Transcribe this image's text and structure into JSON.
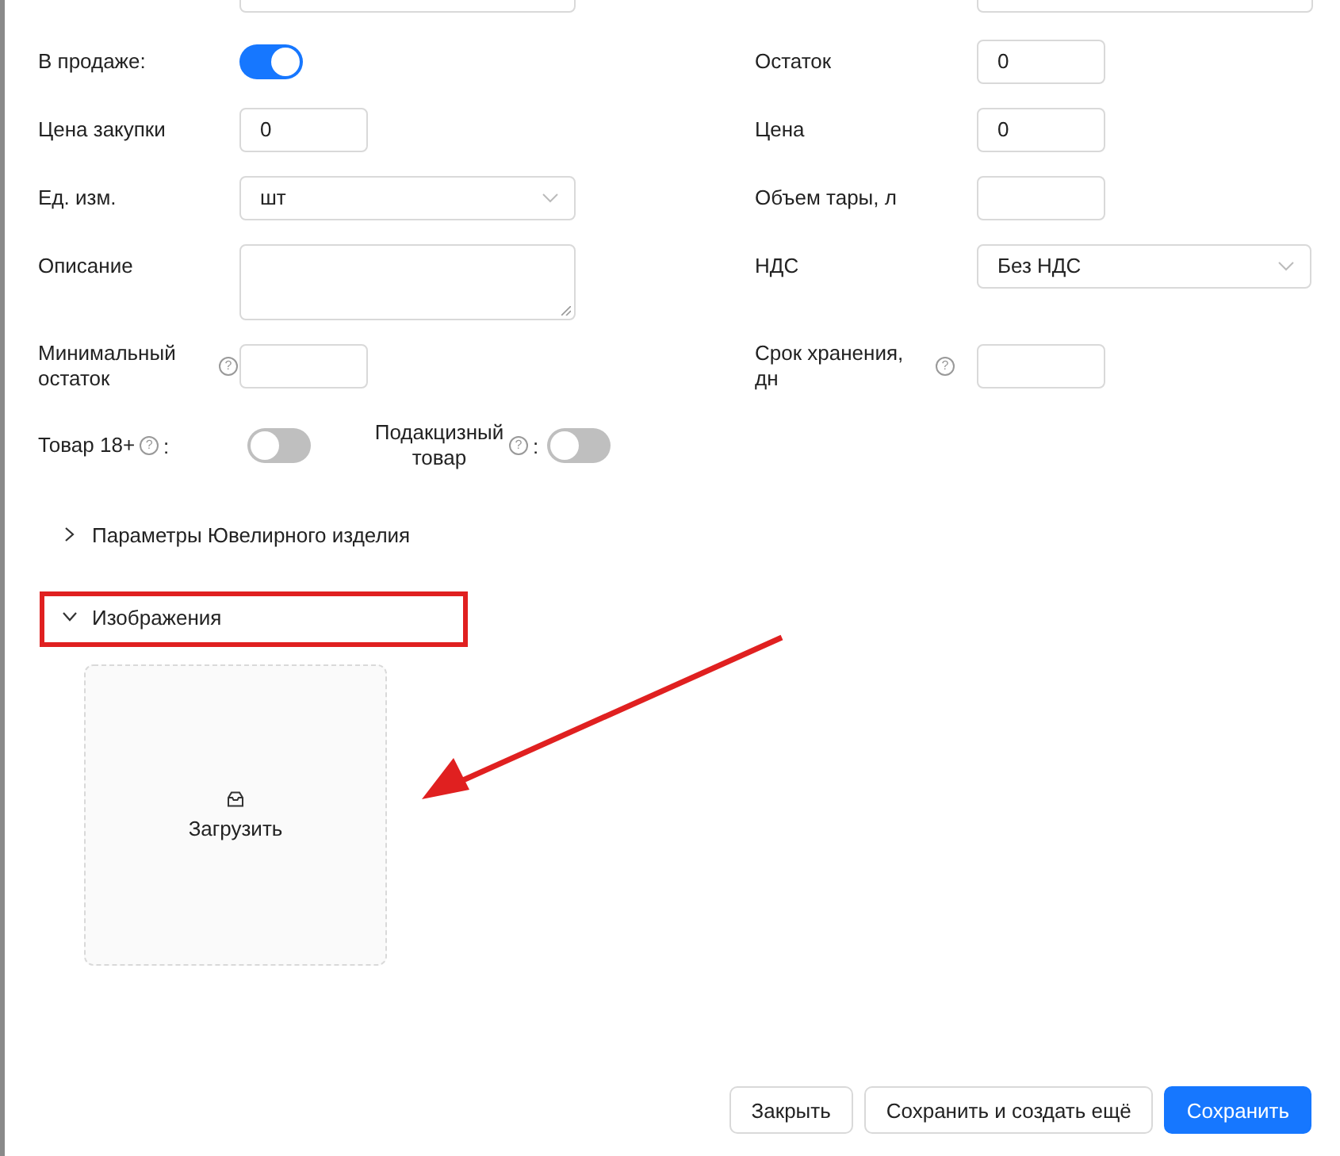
{
  "top_row": [
    {
      "kind": "select"
    },
    {
      "kind": "select"
    }
  ],
  "rows": [
    {
      "left": {
        "kind": "switch",
        "label": "В продаже:",
        "on": true
      },
      "right": {
        "kind": "input",
        "label": "Остаток",
        "value": "0"
      }
    },
    {
      "left": {
        "kind": "input",
        "label": "Цена закупки",
        "value": "0"
      },
      "right": {
        "kind": "input",
        "label": "Цена",
        "value": "0"
      }
    },
    {
      "left": {
        "kind": "select",
        "label": "Ед. изм.",
        "value": "шт"
      },
      "right": {
        "kind": "input",
        "label": "Объем тары, л"
      }
    },
    {
      "left": {
        "kind": "textarea",
        "label": "Описание"
      },
      "right": {
        "kind": "select",
        "label": "НДС",
        "value": "Без НДС"
      }
    },
    {
      "left": {
        "kind": "input",
        "label": "Минимальный остаток",
        "help": "?"
      },
      "right": {
        "kind": "input",
        "label": "Срок хранения, дн",
        "help": "?"
      }
    }
  ],
  "toggles": [
    {
      "label": "Товар 18+",
      "help": "?",
      "suffix": ":",
      "on": false
    },
    {
      "label": "Подакцизный товар",
      "help": "?",
      "suffix": ":",
      "on": false
    }
  ],
  "sections": [
    {
      "title": "Параметры Ювелирного изделия",
      "expanded": false
    },
    {
      "title": "Изображения",
      "expanded": true,
      "highlighted": true
    }
  ],
  "upload": {
    "label": "Загрузить",
    "arrow": true
  },
  "buttons": [
    {
      "label": "Закрыть",
      "kind": "default"
    },
    {
      "label": "Сохранить и создать ещё",
      "kind": "default"
    },
    {
      "label": "Сохранить",
      "kind": "primary"
    }
  ]
}
